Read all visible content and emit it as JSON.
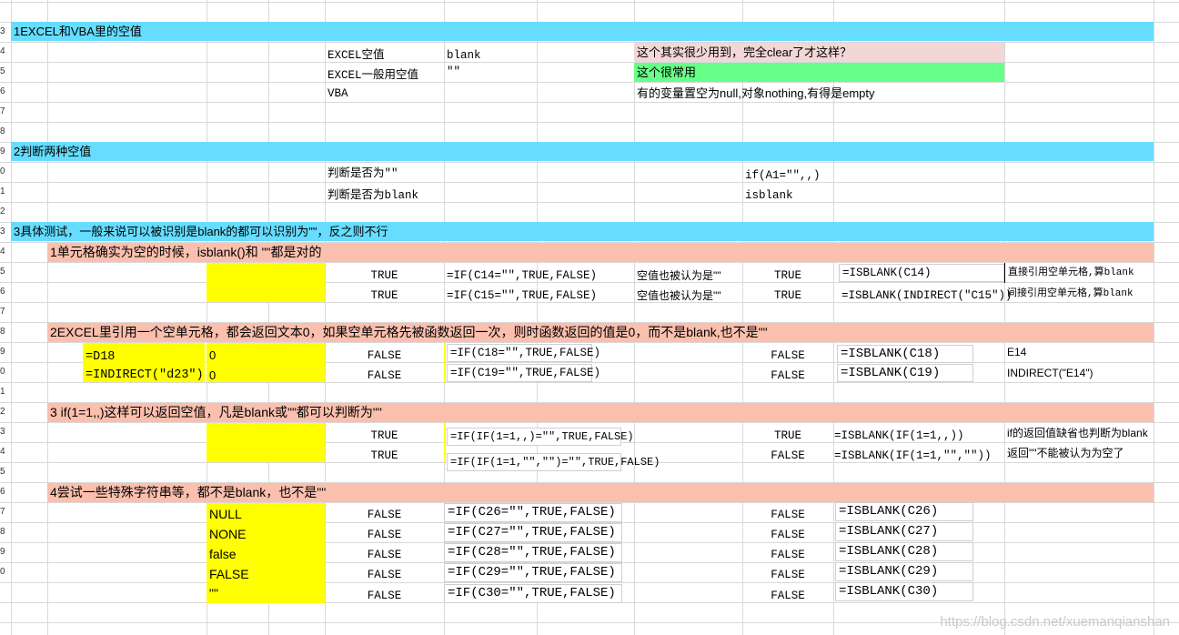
{
  "colors": {
    "section": "#66dcff",
    "subsection": "#fbbfae",
    "highlight": "#ffff00",
    "note_pink": "#f3d6d6",
    "note_green": "#66ff88"
  },
  "row_numbers": [
    "3",
    "4",
    "5",
    "6",
    "7",
    "8",
    "9",
    "0",
    "1",
    "2",
    "3",
    "4",
    "5",
    "6",
    "7",
    "8",
    "9",
    "0",
    "1",
    "2",
    "3",
    "4",
    "5",
    "6",
    "7",
    "8",
    "9",
    "0"
  ],
  "s1": {
    "title": "1EXCEL和VBA里的空值",
    "rows": [
      {
        "label": "EXCEL空值",
        "value": "blank",
        "note": "这个其实很少用到，完全clear了才这样？"
      },
      {
        "label": "EXCEL一般用空值",
        "value": "\"\"",
        "note": "这个很常用"
      },
      {
        "label": "VBA",
        "value": "",
        "note": "有的变量置空为null,对象nothing,有得是empty"
      }
    ]
  },
  "s2": {
    "title": "2判断两种空值",
    "rows": [
      {
        "label": "判断是否为\"\"",
        "value": "if(A1=\"\",,)"
      },
      {
        "label": "判断是否为blank",
        "value": "isblank"
      }
    ]
  },
  "s3": {
    "title": "3具体测试，一般来说可以被识别是blank的都可以识别为\"\"，反之则不行",
    "sub1": {
      "title": "1单元格确实为空的时候，isblank()和 \"\"都是对的",
      "rows": [
        {
          "result1": "TRUE",
          "formula1": "=IF(C14=\"\",TRUE,FALSE)",
          "note": "空值也被认为是\"\"",
          "result2": "TRUE",
          "formula2": "=ISBLANK(C14)",
          "comment": "直接引用空单元格,算blank"
        },
        {
          "result1": "TRUE",
          "formula1": "=IF(C15=\"\",TRUE,FALSE)",
          "note": "空值也被认为是\"\"",
          "result2": "TRUE",
          "formula2": "=ISBLANK(INDIRECT(\"C15\"))",
          "comment": "间接引用空单元格,算blank"
        }
      ]
    },
    "sub2": {
      "title": "2EXCEL里引用一个空单元格，都会返回文本0，如果空单元格先被函数返回一次，则时函数返回的值是0，而不是blank,也不是\"\"",
      "rows": [
        {
          "input": "=D18",
          "input_value": "0",
          "result1": "FALSE",
          "formula1": "=IF(C18=\"\",TRUE,FALSE)",
          "result2": "FALSE",
          "formula2": "=ISBLANK(C18)",
          "comment": "E14"
        },
        {
          "input": "=INDIRECT(\"d23\")",
          "input_value": "0",
          "result1": "FALSE",
          "formula1": "=IF(C19=\"\",TRUE,FALSE)",
          "result2": "FALSE",
          "formula2": "=ISBLANK(C19)",
          "comment": "INDIRECT(\"E14\")"
        }
      ]
    },
    "sub3": {
      "title": "3 if(1=1,,)这样可以返回空值，凡是blank或\"\"都可以判断为\"\"",
      "rows": [
        {
          "result1": "TRUE",
          "formula1": "=IF(IF(1=1,,)=\"\",TRUE,FALSE)",
          "result2": "TRUE",
          "formula2": "=ISBLANK(IF(1=1,,))",
          "comment": "if的返回值缺省也判断为blank"
        },
        {
          "result1": "TRUE",
          "formula1": "=IF(IF(1=1,\"\",\"\")=\"\",TRUE,FALSE)",
          "result2": "FALSE",
          "formula2": "=ISBLANK(IF(1=1,\"\",\"\"))",
          "comment": "返回\"\"不能被认为为空了"
        }
      ]
    },
    "sub4": {
      "title": "4尝试一些特殊字符串等，都不是blank，也不是\"\"",
      "rows": [
        {
          "input": "NULL",
          "result1": "FALSE",
          "formula1": "=IF(C26=\"\",TRUE,FALSE)",
          "result2": "FALSE",
          "formula2": "=ISBLANK(C26)"
        },
        {
          "input": "NONE",
          "result1": "FALSE",
          "formula1": "=IF(C27=\"\",TRUE,FALSE)",
          "result2": "FALSE",
          "formula2": "=ISBLANK(C27)"
        },
        {
          "input": "false",
          "result1": "FALSE",
          "formula1": "=IF(C28=\"\",TRUE,FALSE)",
          "result2": "FALSE",
          "formula2": "=ISBLANK(C28)"
        },
        {
          "input": "FALSE",
          "result1": "FALSE",
          "formula1": "=IF(C29=\"\",TRUE,FALSE)",
          "result2": "FALSE",
          "formula2": "=ISBLANK(C29)"
        },
        {
          "input": "\"\"",
          "result1": "FALSE",
          "formula1": "=IF(C30=\"\",TRUE,FALSE)",
          "result2": "FALSE",
          "formula2": "=ISBLANK(C30)"
        }
      ]
    }
  },
  "watermark": "https://blog.csdn.net/xuemanqianshan"
}
